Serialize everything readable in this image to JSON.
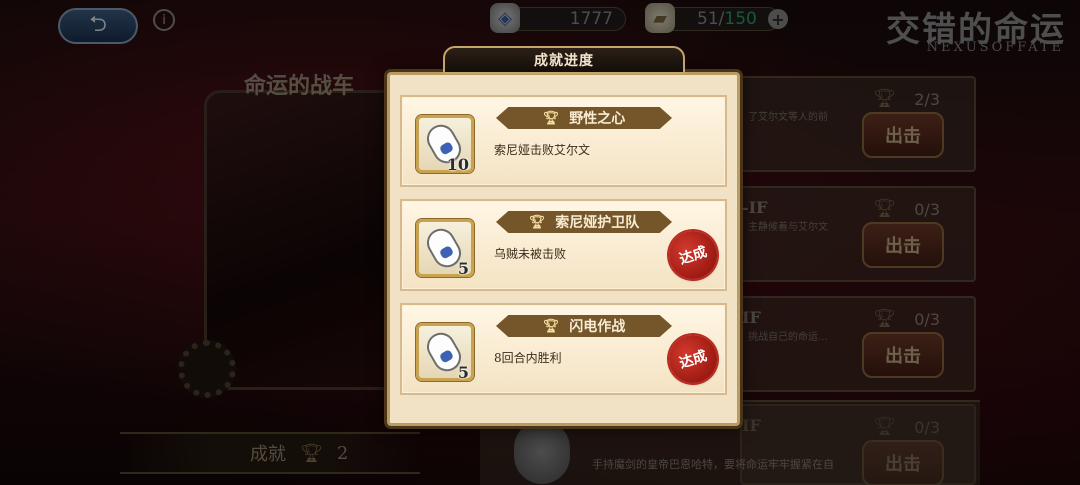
{
  "topbar": {
    "back_icon": "back-arrow-icon",
    "gems": "1777",
    "stamina_current": "51",
    "stamina_separator": "/",
    "stamina_max": "150",
    "add_label": "+",
    "logo_cn": "交错的命运",
    "logo_en": "NEXUSOFFATE"
  },
  "left_page": {
    "chapter_title": "命运的战车",
    "achievement_label": "成就",
    "achievement_count": "2"
  },
  "quest_list": [
    {
      "tag": "",
      "count": "2/3",
      "desc": "了艾尔文等人的前",
      "button": "出击"
    },
    {
      "tag": "-IF",
      "count": "0/3",
      "desc": "主静候着与艾尔文",
      "button": "出击"
    },
    {
      "tag": "IF",
      "count": "0/3",
      "desc": "挑战自己的命运…",
      "button": "出击"
    },
    {
      "tag": "IF",
      "count": "0/3",
      "desc": "",
      "button": "出击"
    }
  ],
  "bottom_quest": {
    "desc": "手持魔剑的皇帝巴恩哈特，要将命运牢牢握紧在自"
  },
  "modal": {
    "title": "成就进度",
    "achievements": [
      {
        "name": "野性之心",
        "desc": "索尼娅击败艾尔文",
        "reward_qty": "10",
        "completed": false,
        "stamp": ""
      },
      {
        "name": "索尼娅护卫队",
        "desc": "乌贼未被击败",
        "reward_qty": "5",
        "completed": true,
        "stamp": "达成"
      },
      {
        "name": "闪电作战",
        "desc": "8回合内胜利",
        "reward_qty": "5",
        "completed": true,
        "stamp": "达成"
      }
    ]
  },
  "colors": {
    "modal_bg": "#f1e2c6",
    "ribbon": "#74562a",
    "stamp_red": "#c0281f",
    "stamina_max": "#2fa06a"
  }
}
